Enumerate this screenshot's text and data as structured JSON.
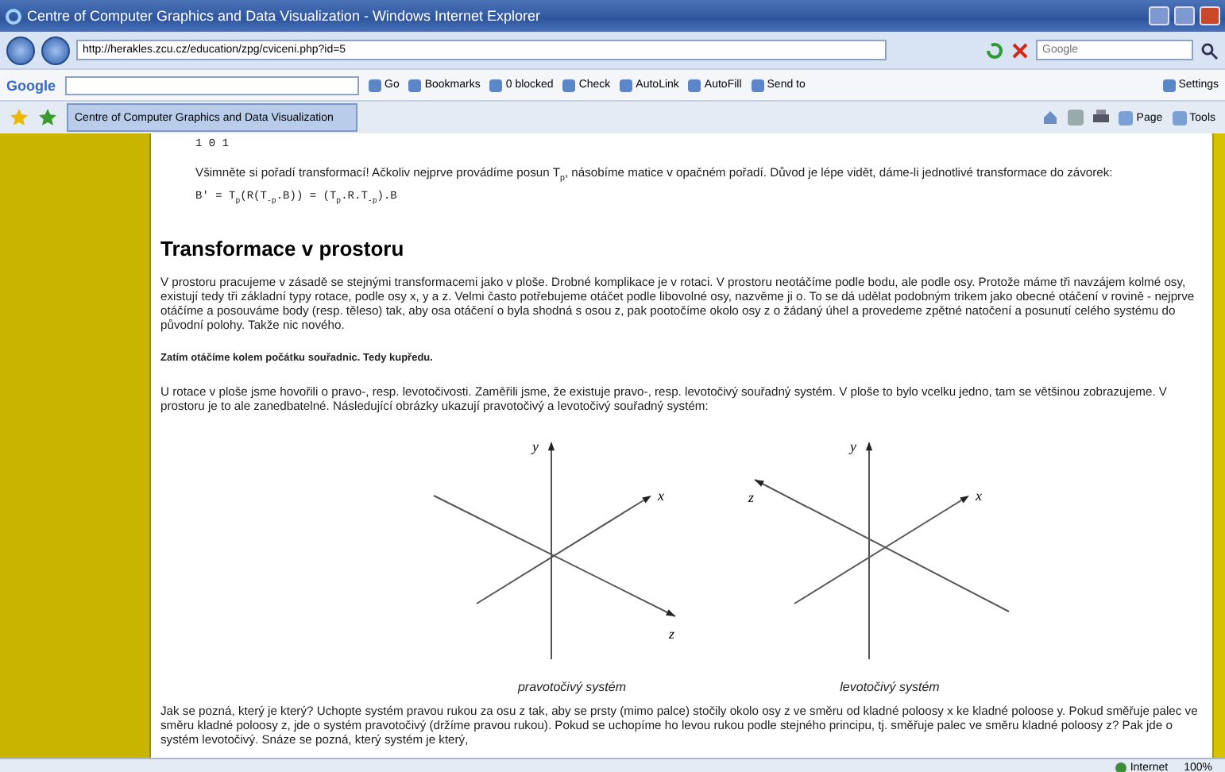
{
  "window": {
    "title": "Centre of Computer Graphics and Data Visualization - Windows Internet Explorer"
  },
  "address_bar": {
    "url": "http://herakles.zcu.cz/education/zpg/cviceni.php?id=5"
  },
  "search": {
    "placeholder": "Google"
  },
  "google_toolbar": {
    "brand": "Google",
    "items": [
      {
        "label": "Go"
      },
      {
        "label": "Bookmarks"
      },
      {
        "label": "0 blocked"
      },
      {
        "label": "Check"
      },
      {
        "label": "AutoLink"
      },
      {
        "label": "AutoFill"
      },
      {
        "label": "Send to"
      }
    ],
    "settings": "Settings"
  },
  "tabs": [
    {
      "title": "Centre of Computer Graphics and Data Visualization",
      "selected": true
    }
  ],
  "command_bar": [
    {
      "label": "Page"
    },
    {
      "label": "Tools"
    }
  ],
  "content": [
    {
      "kind": "formula",
      "text": "1   0   1"
    },
    {
      "kind": "text",
      "text": "Všimněte si pořadí transformací! Ačkoliv nejprve provádíme posun T$_{p}$, násobíme matice v opačném pořadí. Důvod je lépe vidět, dáme-li jednotlivé transformace do závorek:"
    },
    {
      "kind": "formula",
      "text": "B' = T$_{p}$(R(T$_{-p}$.B)) = (T$_{p}$.R.T$_{-p}$).B"
    },
    {
      "kind": "heading",
      "text": "Transformace v prostoru"
    },
    {
      "kind": "text",
      "text": "V prostoru pracujeme v zásadě se stejnými transformacemi jako v ploše. Drobné komplikace je v rotaci. V prostoru neotáčíme podle bodu, ale podle osy. Protože máme tři navzájem kolmé osy, existují tedy tři základní typy rotace, podle osy x, y a z. Velmi často potřebujeme otáčet podle libovolné osy, nazvěme ji o. To se dá udělat podobným trikem jako obecné otáčení v rovině - nejprve otáčíme a posouváme body (resp. těleso) tak, aby osa otáčení o byla shodná s osou z, pak pootočíme okolo osy z o žádaný úhel a provedeme zpětné natočení a posunutí celého systému do původní polohy. Takže nic nového."
    },
    {
      "kind": "note",
      "text": "Zatím otáčíme kolem počátku souřadnic. Tedy kupředu."
    },
    {
      "kind": "text",
      "text": "U rotace v ploše jsme hovořili o pravo-, resp. levotočivosti. Zaměřili jsme, že existuje pravo-, resp. levotočivý souřadný systém. V ploše to bylo vcelku jedno, tam se většinou zobrazujeme. V prostoru je to ale zanedbatelné. Následující obrázky ukazují pravotočivý a levotočivý souřadný systém:"
    },
    {
      "kind": "figure",
      "systems": [
        {
          "kind": "right-handed",
          "y": "y",
          "x": "x",
          "z": "z",
          "caption": "pravotočivý systém"
        },
        {
          "kind": "left-handed",
          "y": "y",
          "x": "x",
          "z": "z",
          "caption": "levotočivý systém"
        }
      ]
    },
    {
      "kind": "text",
      "text": "Jak se pozná, který je který? Uchopte systém pravou rukou za osu z tak, aby se prsty (mimo palce) stočily okolo osy z ve směru od kladné poloosy x ke kladné poloose y. Pokud směřuje palec ve směru kladné poloosy z, jde o systém pravotočivý (držíme pravou rukou). Pokud se uchopíme ho levou rukou podle stejného principu, tj. směřuje palec ve směru kladné poloosy z? Pak jde o systém levotočivý. Snáze se pozná, který systém je který,"
    }
  ],
  "status_bar": {
    "zone": "Internet",
    "zoom": "100%"
  }
}
